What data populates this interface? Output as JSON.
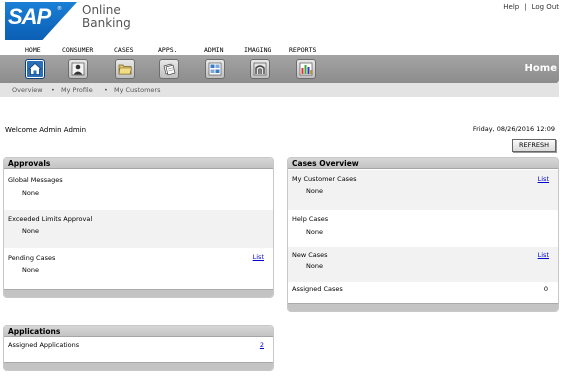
{
  "brand": {
    "logo_text": "SAP",
    "registered_mark": "®",
    "product_line1": "Online",
    "product_line2": "Banking",
    "logo_color": "#1a7fd6"
  },
  "top_links": {
    "help": "Help",
    "separator": "|",
    "logout": "Log Out"
  },
  "nav": {
    "items": [
      {
        "label": "HOME",
        "icon": "home-icon",
        "active": true
      },
      {
        "label": "CONSUMER",
        "icon": "person-icon",
        "active": false
      },
      {
        "label": "CASES",
        "icon": "folder-icon",
        "active": false
      },
      {
        "label": "APPS.",
        "icon": "documents-icon",
        "active": false
      },
      {
        "label": "ADMIN",
        "icon": "admin-icon",
        "active": false
      },
      {
        "label": "IMAGING",
        "icon": "imaging-icon",
        "active": false
      },
      {
        "label": "REPORTS",
        "icon": "bar-chart-icon",
        "active": false
      }
    ],
    "current_section": "Home",
    "active_color": "#2b6fb6"
  },
  "subnav": {
    "items": [
      "Overview",
      "My Profile",
      "My Customers"
    ],
    "bullet": "•"
  },
  "welcome": "Welcome Admin Admin",
  "datetime": "Friday, 08/26/2016 12:09",
  "refresh_label": "REFRESH",
  "approvals": {
    "title": "Approvals",
    "rows": [
      {
        "label": "Global Messages",
        "value": "None"
      },
      {
        "label": "Exceeded Limits Approval",
        "value": "None"
      },
      {
        "label": "Pending Cases",
        "value": "None",
        "link": "List"
      }
    ]
  },
  "cases_overview": {
    "title": "Cases Overview",
    "rows": [
      {
        "label": "My Customer Cases",
        "value": "None",
        "link": "List"
      },
      {
        "label": "Help Cases",
        "value": "None"
      },
      {
        "label": "New Cases",
        "value": "None",
        "link": "List"
      },
      {
        "label": "Assigned Cases",
        "count": "0"
      }
    ]
  },
  "applications": {
    "title": "Applications",
    "rows": [
      {
        "label": "Assigned Applications",
        "link": "2"
      }
    ]
  }
}
